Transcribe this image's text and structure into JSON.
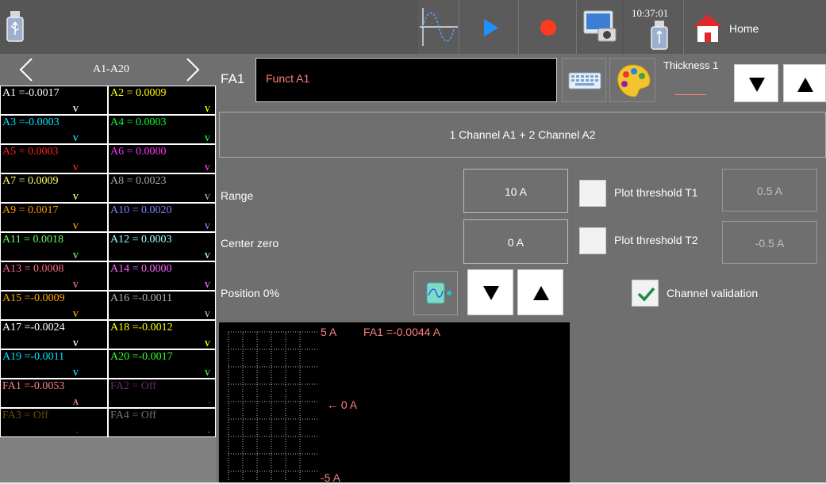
{
  "topbar": {
    "clock": "10:37:01",
    "home_label": "Home",
    "icons": [
      "usb-icon",
      "waveform-icon",
      "play-icon",
      "record-icon",
      "screenshot-icon",
      "usb-icon",
      "home-icon"
    ],
    "colors": {
      "play": "#1e90ff",
      "record": "#ff3b1f"
    }
  },
  "channels_nav": {
    "label": "A1-A20",
    "cells": [
      {
        "text": "A1 =-0.0017",
        "unit": "V",
        "color": "#ffffff"
      },
      {
        "text": "A2 = 0.0009",
        "unit": "V",
        "color": "#ffff00"
      },
      {
        "text": "A3 =-0.0003",
        "unit": "V",
        "color": "#00e5ff"
      },
      {
        "text": "A4 = 0.0003",
        "unit": "V",
        "color": "#00ff33"
      },
      {
        "text": "A5 = 0.0003",
        "unit": "V",
        "color": "#ff2020"
      },
      {
        "text": "A6 = 0.0000",
        "unit": "V",
        "color": "#ff33ff"
      },
      {
        "text": "A7 = 0.0009",
        "unit": "V",
        "color": "#ffff66"
      },
      {
        "text": "A8 = 0.0023",
        "unit": "V",
        "color": "#a6a6a6"
      },
      {
        "text": "A9 = 0.0017",
        "unit": "V",
        "color": "#ff9900"
      },
      {
        "text": "A10 = 0.0020",
        "unit": "V",
        "color": "#8080ff"
      },
      {
        "text": "A11 = 0.0018",
        "unit": "V",
        "color": "#66ff66"
      },
      {
        "text": "A12 = 0.0003",
        "unit": "V",
        "color": "#99ffff"
      },
      {
        "text": "A13 = 0.0008",
        "unit": "V",
        "color": "#ff6688"
      },
      {
        "text": "A14 = 0.0000",
        "unit": "V",
        "color": "#ff66ff"
      },
      {
        "text": "A15 =-0.0009",
        "unit": "V",
        "color": "#ffaa00"
      },
      {
        "text": "A16 =-0.0011",
        "unit": "V",
        "color": "#b0b0b0"
      },
      {
        "text": "A17 =-0.0024",
        "unit": "V",
        "color": "#ffffff"
      },
      {
        "text": "A18 =-0.0012",
        "unit": "V",
        "color": "#ffff00"
      },
      {
        "text": "A19 =-0.0011",
        "unit": "V",
        "color": "#00e5ff"
      },
      {
        "text": "A20 =-0.0017",
        "unit": "V",
        "color": "#33ff33"
      },
      {
        "text": "FA1 =-0.0053",
        "unit": "A",
        "color": "#ff8080"
      },
      {
        "text": "FA2 = Off",
        "unit": "-",
        "color": "#6a2a6a"
      },
      {
        "text": "FA3 = Off",
        "unit": "-",
        "color": "#6a4a10"
      },
      {
        "text": "FA4 = Off",
        "unit": "-",
        "color": "#707070"
      }
    ]
  },
  "function": {
    "label": "FA1",
    "name": "Funct A1",
    "formula": "1 Channel A1 + 2 Channel A2",
    "thickness_label": "Thickness 1",
    "color": "#ff8080"
  },
  "settings": {
    "range_label": "Range",
    "range_value": "10 A",
    "center_label": "Center zero",
    "center_value": "0 A",
    "position_label": "Position 0%"
  },
  "thresholds": {
    "t1_label": "Plot threshold T1",
    "t1_value": "0.5 A",
    "t1_checked": false,
    "t2_label": "Plot threshold T2",
    "t2_value": "-0.5 A",
    "t2_checked": false,
    "validation_label": "Channel validation",
    "validation_checked": true
  },
  "plot": {
    "top_label": "5 A",
    "readout": "FA1 =-0.0044 A",
    "zero_label": "← 0 A",
    "bottom_label": "-5 A"
  }
}
